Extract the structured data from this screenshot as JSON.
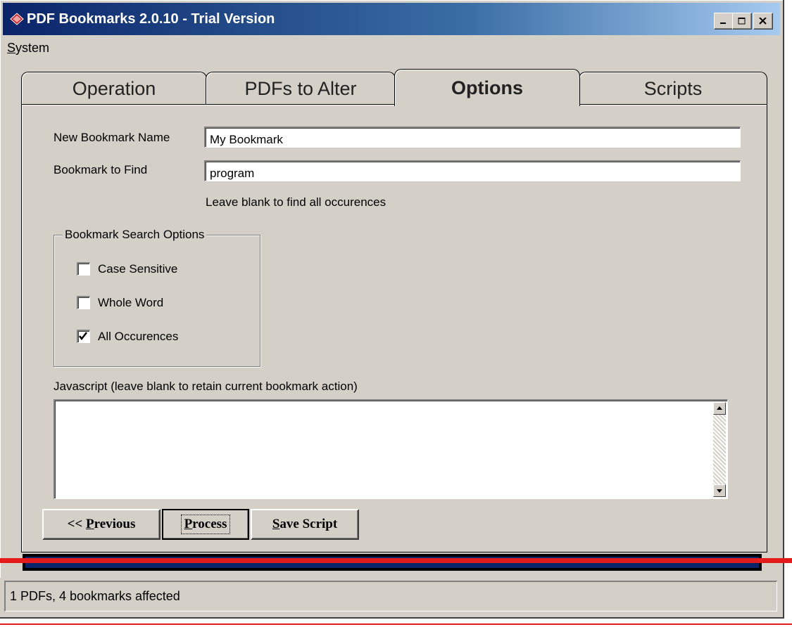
{
  "window": {
    "title": "PDF Bookmarks 2.0.10 - Trial Version",
    "accent": "#0a246a"
  },
  "menu": {
    "items": [
      {
        "label_prefix": "",
        "label_underlined": "S",
        "label_rest": "ystem"
      }
    ]
  },
  "tabs": [
    {
      "label": "Operation",
      "active": false
    },
    {
      "label": "PDFs to Alter",
      "active": false
    },
    {
      "label": "Options",
      "active": true
    },
    {
      "label": "Scripts",
      "active": false
    }
  ],
  "options": {
    "new_bookmark_label": "New Bookmark Name",
    "new_bookmark_value": "My Bookmark",
    "find_label": "Bookmark to Find",
    "find_value": "program",
    "find_hint": "Leave blank to find all occurences",
    "search_group_title": "Bookmark Search Options",
    "checkboxes": [
      {
        "label": "Case Sensitive",
        "checked": false
      },
      {
        "label": "Whole Word",
        "checked": false
      },
      {
        "label": "All Occurences",
        "checked": true
      }
    ],
    "javascript_label": "Javascript (leave blank to retain current bookmark action)",
    "javascript_value": ""
  },
  "buttons": {
    "prev_prefix": "<< ",
    "prev_underlined": "P",
    "prev_rest": "revious",
    "process_underlined": "P",
    "process_rest": "rocess",
    "save_underlined": "S",
    "save_rest": "ave Script"
  },
  "progress": {
    "value": 1.0,
    "color": "#0a246a"
  },
  "status": {
    "text": "1 PDFs, 4 bookmarks affected"
  },
  "annotation_color": "#e31b1b"
}
